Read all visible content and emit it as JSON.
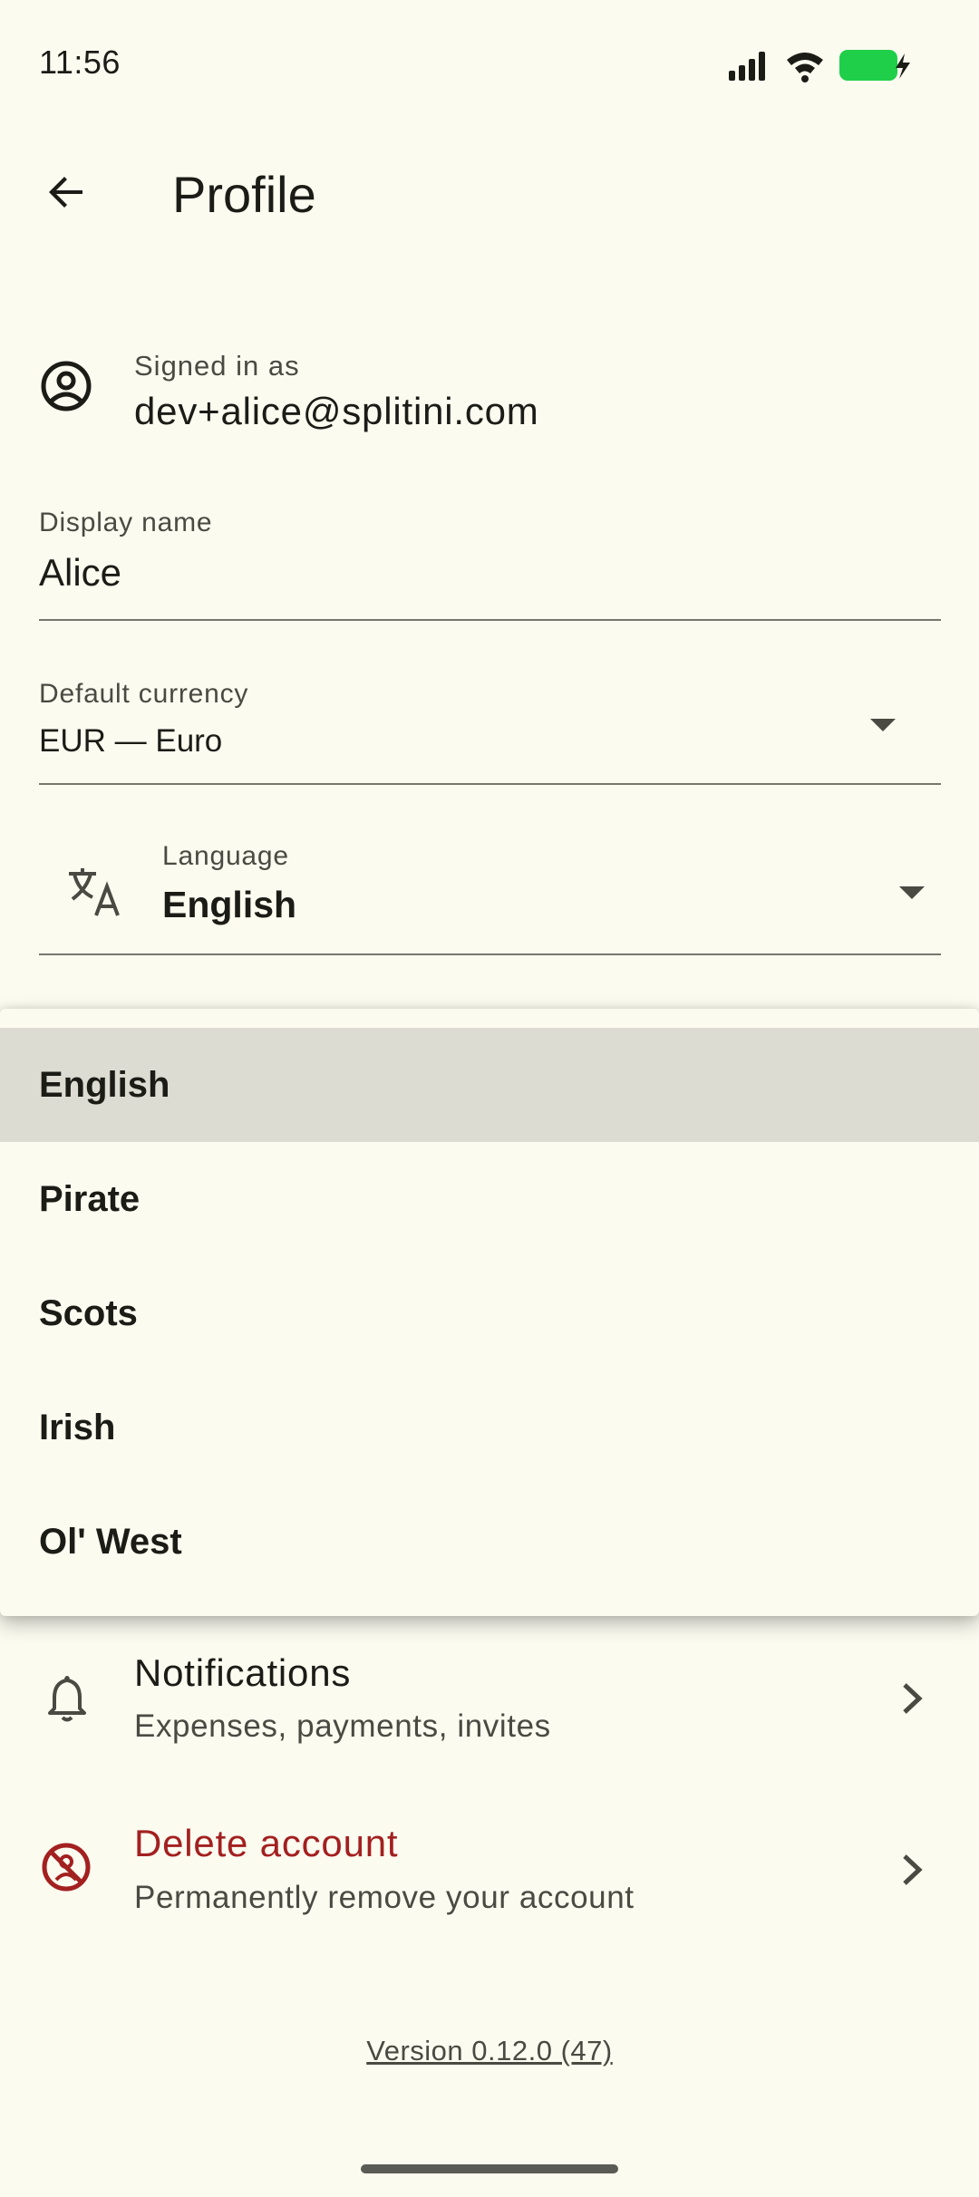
{
  "status_bar": {
    "time": "11:56",
    "icons": [
      "signal-icon",
      "wifi-icon",
      "battery-charging-icon"
    ],
    "battery_color": "#1fcf4a"
  },
  "app_bar": {
    "back_icon": "arrow-back-icon",
    "title": "Profile"
  },
  "account": {
    "icon": "account-circle-icon",
    "signed_in_label": "Signed in as",
    "email": "dev+alice@splitini.com"
  },
  "display_name": {
    "label": "Display name",
    "value": "Alice"
  },
  "default_currency": {
    "label": "Default currency",
    "value": "EUR — Euro"
  },
  "language": {
    "icon": "translate-icon",
    "label": "Language",
    "value": "English",
    "options": [
      "English",
      "Pirate",
      "Scots",
      "Irish",
      "Ol' West"
    ],
    "selected_index": 0
  },
  "rows": {
    "notifications": {
      "icon": "bell-icon",
      "title": "Notifications",
      "subtitle": "Expenses, payments, invites"
    },
    "delete_account": {
      "icon": "delete-account-icon",
      "title": "Delete account",
      "subtitle": "Permanently remove your account",
      "color": "#a32020"
    }
  },
  "version": "Version 0.12.0 (47)",
  "colors": {
    "background": "#fbfbf0",
    "menu_selected": "#dddcd3",
    "danger": "#a32020"
  }
}
